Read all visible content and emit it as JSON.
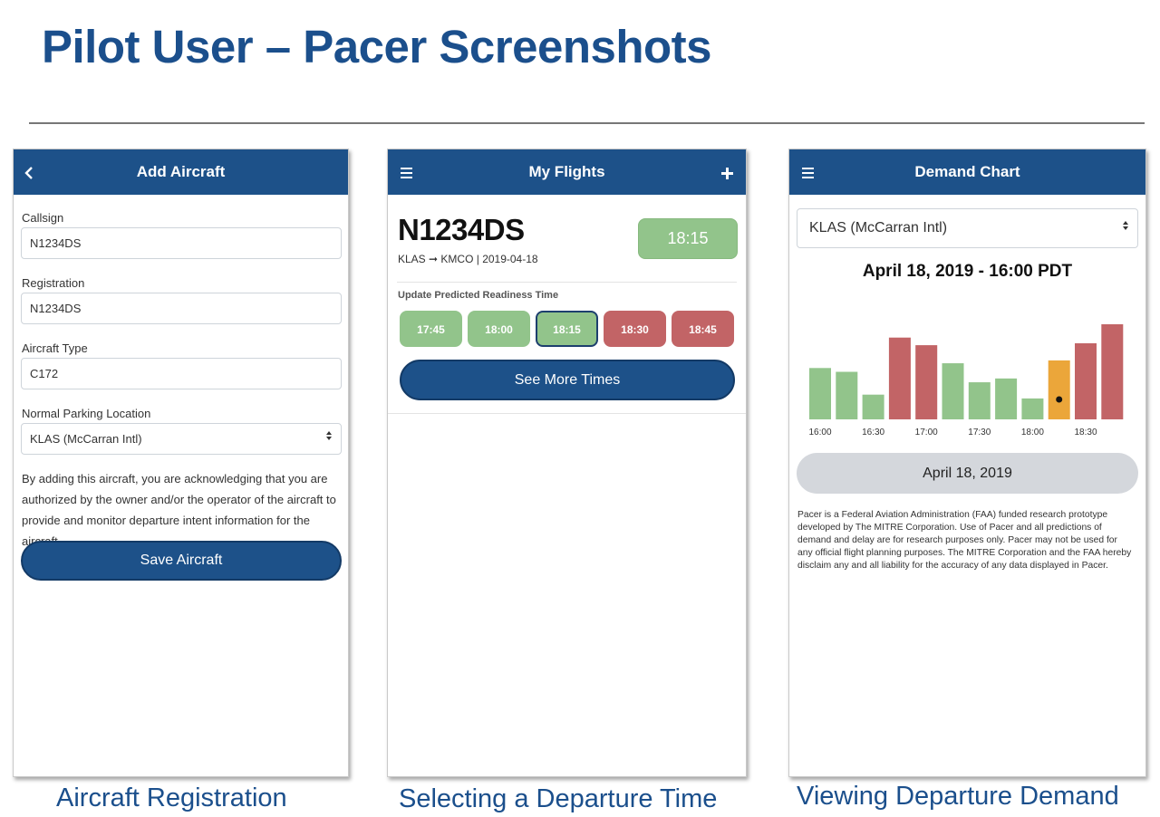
{
  "slide": {
    "title": "Pilot User – Pacer Screenshots"
  },
  "captions": {
    "left": "Aircraft Registration",
    "middle": "Selecting a Departure Time",
    "right": "Viewing Departure Demand"
  },
  "colors": {
    "appbar": "#1d5189",
    "title_text": "#1b4f8c",
    "green": "#92c48b",
    "red": "#c26466",
    "orange": "#eba63a"
  },
  "add_aircraft": {
    "back_icon": "chevron-left-icon",
    "title": "Add Aircraft",
    "callsign_label": "Callsign",
    "callsign_value": "N1234DS",
    "registration_label": "Registration",
    "registration_value": "N1234DS",
    "type_label": "Aircraft Type",
    "type_value": "C172",
    "parking_label": "Normal Parking Location",
    "parking_value": "KLAS (McCarran Intl)",
    "disclaimer": "By adding this aircraft, you are acknowledging that you are authorized by the owner and/or the operator of the aircraft to provide and monitor departure intent information for the aircraft.",
    "save_label": "Save Aircraft"
  },
  "my_flights": {
    "menu_icon": "hamburger-menu-icon",
    "add_icon": "plus-icon",
    "title": "My Flights",
    "callsign": "N1234DS",
    "route": "KLAS ➞ KMCO | 2019-04-18",
    "predicted_time": "18:15",
    "readiness_label": "Update Predicted Readiness Time",
    "slots": [
      {
        "time": "17:45",
        "status": "green",
        "selected": false
      },
      {
        "time": "18:00",
        "status": "green",
        "selected": false
      },
      {
        "time": "18:15",
        "status": "green",
        "selected": true
      },
      {
        "time": "18:30",
        "status": "red",
        "selected": false
      },
      {
        "time": "18:45",
        "status": "red",
        "selected": false
      }
    ],
    "more_label": "See More Times"
  },
  "demand_chart": {
    "menu_icon": "hamburger-menu-icon",
    "title": "Demand Chart",
    "airport_value": "KLAS (McCarran Intl)",
    "heading": "April 18, 2019 - 16:00 PDT",
    "date_button": "April 18, 2019",
    "legal": "Pacer is a Federal Aviation Administration (FAA) funded research prototype developed by The MITRE Corporation. Use of Pacer and all predictions of demand and delay are for research purposes only. Pacer may not be used for any official flight planning purposes. The MITRE Corporation and the FAA hereby disclaim any and all liability for the accuracy of any data displayed in Pacer."
  },
  "chart_data": {
    "type": "bar",
    "categories": [
      "16:00",
      "16:15",
      "16:30",
      "16:45",
      "17:00",
      "17:15",
      "17:30",
      "17:45",
      "18:00",
      "18:15",
      "18:30",
      "18:45"
    ],
    "tick_labels": [
      "16:00",
      "16:30",
      "17:00",
      "17:30",
      "18:00",
      "18:30"
    ],
    "values": [
      5.4,
      5.0,
      2.6,
      8.6,
      7.8,
      5.9,
      3.9,
      4.3,
      2.2,
      6.2,
      8.0,
      10.0
    ],
    "statuses": [
      "green",
      "green",
      "green",
      "red",
      "red",
      "green",
      "green",
      "green",
      "green",
      "orange",
      "red",
      "red"
    ],
    "selected_index": 9,
    "ylim": [
      0,
      10
    ],
    "grid": false,
    "legend": "none"
  }
}
